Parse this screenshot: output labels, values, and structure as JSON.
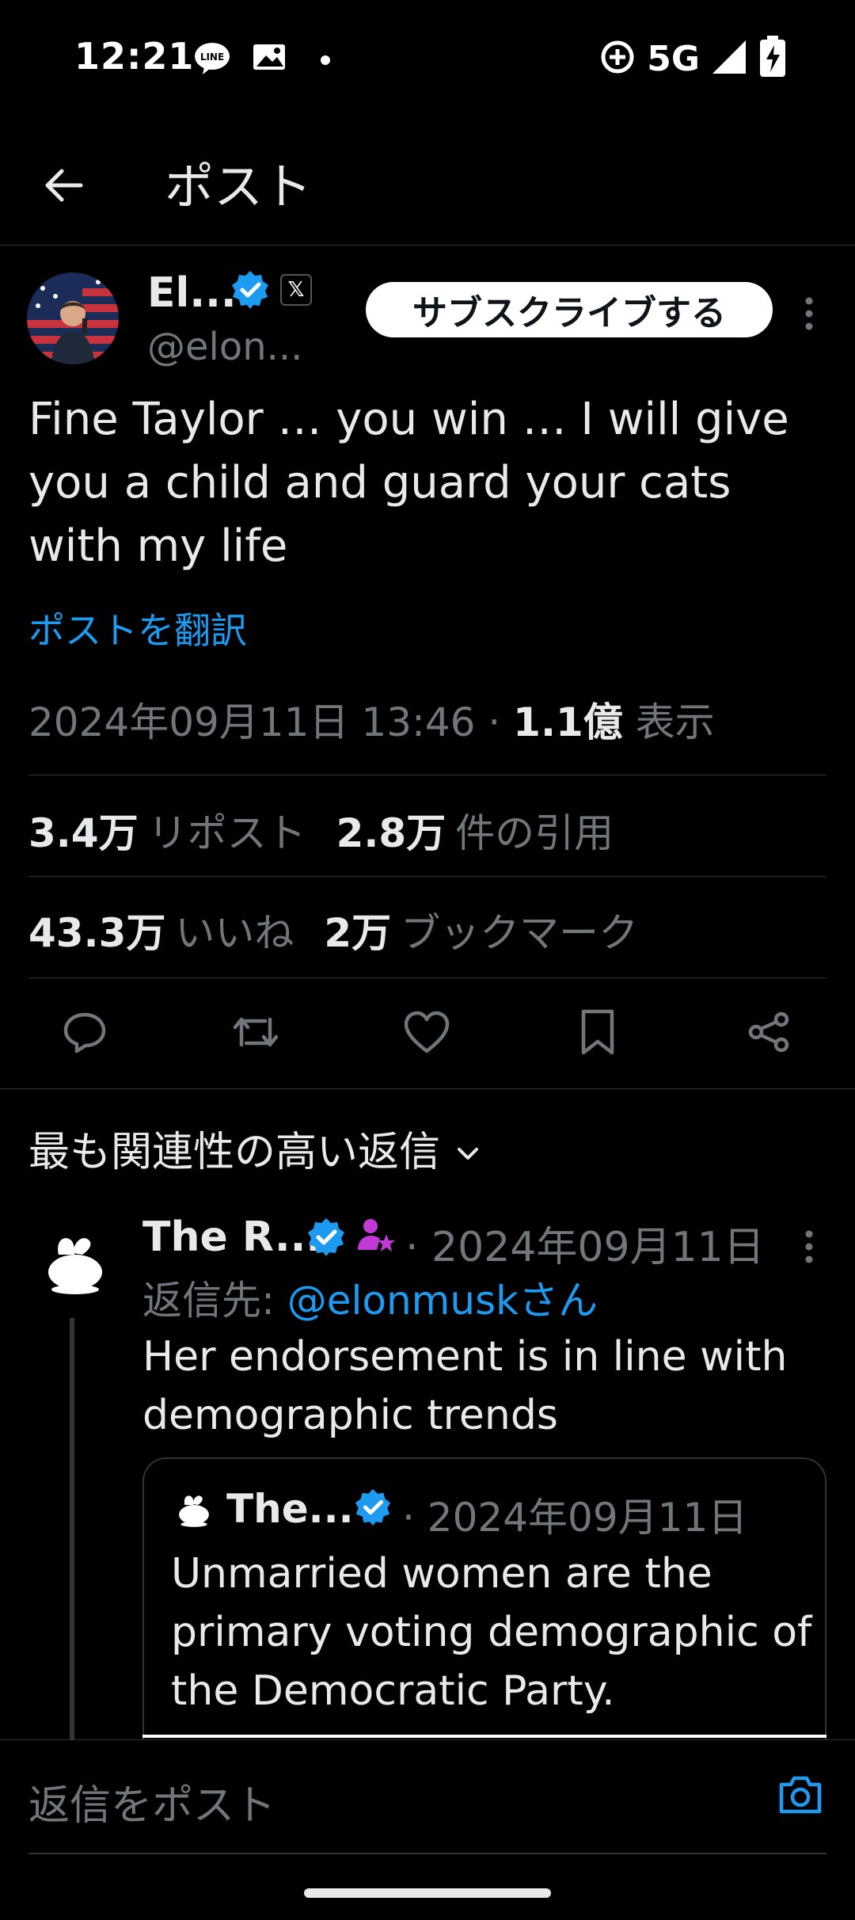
{
  "status_bar": {
    "time": "12:21",
    "network": "5G",
    "icons": [
      "line-icon",
      "image-icon",
      "dot-icon",
      "sync-icon",
      "signal-icon",
      "battery-charging-icon"
    ]
  },
  "top_bar": {
    "title": "ポスト",
    "back_icon": "arrow-left-icon"
  },
  "post": {
    "author_name": "El...",
    "author_handle": "@elon...",
    "affiliation_label": "𝕏",
    "subscribe_label": "サブスクライブする",
    "text": "Fine Taylor … you win … I will give you a child and guard your cats with my life",
    "translate_label": "ポストを翻訳",
    "datetime": "2024年09月11日 13:46 · ",
    "views_count": "1.1億",
    "views_label": " 表示",
    "stats": {
      "reposts_count": "3.4万",
      "reposts_label": "リポスト",
      "quotes_count": "2.8万",
      "quotes_label": "件の引用",
      "likes_count": "43.3万",
      "likes_label": "いいね",
      "bookmarks_count": "2万",
      "bookmarks_label": "ブックマーク"
    },
    "accent_color": "#1d9bf0"
  },
  "replies": {
    "sort_label": "最も関連性の高い返信",
    "items": [
      {
        "name": "The R...",
        "date": "· 2024年09月11日",
        "reply_to_prefix": "返信先: ",
        "reply_to_mention": "@elonmuskさん",
        "text": "Her endorsement is in line with demographic trends",
        "quote": {
          "name": "The...",
          "date": "· 2024年09月11日",
          "text": "Unmarried women are the primary voting demographic of the Democratic Party."
        }
      }
    ]
  },
  "composer": {
    "placeholder": "返信をポスト"
  }
}
